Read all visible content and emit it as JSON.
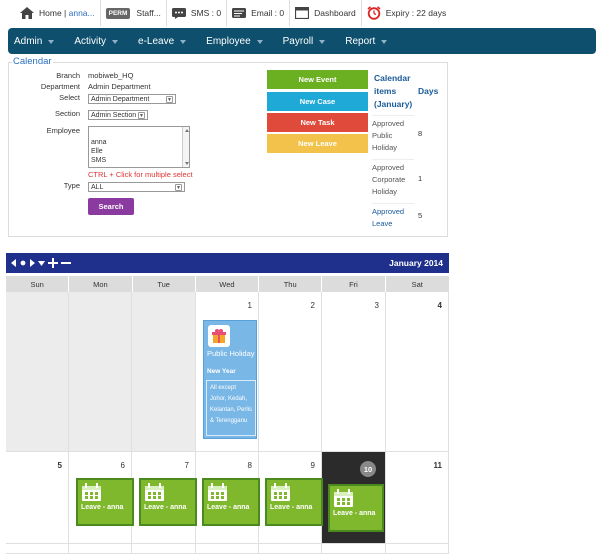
{
  "topbar": {
    "home_label": "Home |",
    "user": "anna...",
    "perm_badge": "PERM",
    "staff_label": "Staff...",
    "sms_label": "SMS : 0",
    "email_label": "Email : 0",
    "dashboard_label": "Dashboard",
    "expiry_label": "Expiry : 22 days"
  },
  "nav": {
    "items": [
      "Admin",
      "Activity",
      "e-Leave",
      "Employee",
      "Payroll",
      "Report"
    ]
  },
  "filter": {
    "legend": "Calendar",
    "branch_label": "Branch",
    "branch_value": "mobiweb_HQ",
    "department_label": "Department",
    "department_value": "Admin Department",
    "select_label": "Select",
    "select_value": "Admin Department",
    "section_label": "Section",
    "section_value": "Admin Section",
    "employee_label": "Employee",
    "employee_options": [
      "anna",
      "Elle",
      "SMS"
    ],
    "hint": "CTRL + Click for multiple select",
    "type_label": "Type",
    "type_value": "ALL",
    "search_button": "Search"
  },
  "actions": {
    "new_event": "New Event",
    "new_case": "New Case",
    "new_task": "New Task",
    "new_leave": "New Leave"
  },
  "legend_table": {
    "header_items": "Calendar items (January)",
    "header_days": "Days",
    "rows": [
      {
        "label": "Approved Public Holiday",
        "days": "8"
      },
      {
        "label": "Approved Corporate Holiday",
        "days": "1"
      },
      {
        "label": "Approved Leave",
        "days": "5"
      }
    ]
  },
  "calendar": {
    "month_title": "January 2014",
    "weekdays": [
      "Sun",
      "Mon",
      "Tue",
      "Wed",
      "Thu",
      "Fri",
      "Sat"
    ],
    "week1": [
      "",
      "",
      "",
      "1",
      "2",
      "3",
      "4"
    ],
    "week2": [
      "5",
      "6",
      "7",
      "8",
      "9",
      "10",
      "11"
    ],
    "holiday_event": {
      "title": "Public Holiday",
      "subtitle": "New Year",
      "states": "All except Johor, Kedah, Kelantan, Perlis & Terengganu"
    },
    "leave_event_text": "Leave - anna"
  },
  "colors": {
    "nav_bg": "#0d4f6d",
    "month_header": "#1e2f8c",
    "new_event": "#6ab020",
    "new_case": "#1fa9d6",
    "new_task": "#e04a3a",
    "new_leave": "#f2c24a",
    "leave": "#7fb82d",
    "holiday": "#79b7e6",
    "search_button": "#8b3a9f"
  }
}
